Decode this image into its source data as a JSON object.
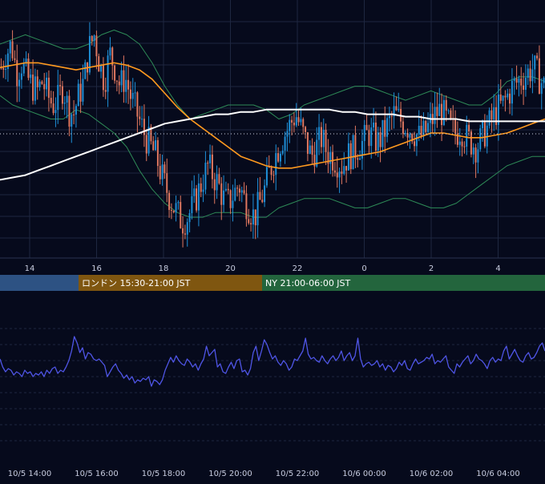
{
  "colors": {
    "background": "#060a1c",
    "grid": "#1e2740",
    "candle_up": "#1e90d8",
    "candle_down": "#e07860",
    "bollinger": "#2e8b57",
    "ma_short": "#ff9a1f",
    "ma_long": "#ffffff",
    "oscillator": "#4f55e6",
    "axis_text": "#c8cde0",
    "session_tokyo": "#2d5283",
    "session_london": "#7f5610",
    "session_ny": "#23653d",
    "current_price_line": "#cfd3e0"
  },
  "sessions": [
    {
      "label": "",
      "color_key": "session_tokyo"
    },
    {
      "label": "ロンドン 15:30-21:00 JST",
      "color_key": "session_london"
    },
    {
      "label": "NY 21:00-06:00 JST",
      "color_key": "session_ny"
    }
  ],
  "main_axis": {
    "tick_labels": [
      "14",
      "16",
      "18",
      "20",
      "22",
      "0",
      "2",
      "4"
    ]
  },
  "bottom_axis": {
    "tick_labels": [
      "10/5 14:00",
      "10/5 16:00",
      "10/5 18:00",
      "10/5 20:00",
      "10/5 22:00",
      "10/6 00:00",
      "10/6 02:00",
      "10/6 04:00"
    ]
  },
  "chart_data": [
    {
      "type": "line",
      "subtype": "candlestick",
      "title": "",
      "x_start": "10/5 13:00",
      "x_end": "10/6 05:40",
      "candle_interval_minutes": 5,
      "ylim": [
        0,
        100
      ],
      "grid": true,
      "legend": "none",
      "close_series": [
        78,
        84,
        88,
        76,
        80,
        74,
        70,
        68,
        72,
        66,
        62,
        64,
        70,
        60,
        58,
        66,
        72,
        86,
        92,
        80,
        72,
        84,
        78,
        70,
        74,
        66,
        60,
        54,
        48,
        44,
        40,
        32,
        26,
        20,
        16,
        12,
        14,
        18,
        24,
        30,
        36,
        32,
        28,
        22,
        20,
        24,
        28,
        22,
        18,
        14,
        20,
        26,
        34,
        40,
        46,
        50,
        54,
        58,
        52,
        46,
        40,
        44,
        48,
        42,
        40,
        38,
        36,
        40,
        42,
        44,
        46,
        50,
        48,
        46,
        50,
        54,
        58,
        56,
        54,
        52,
        50,
        48,
        50,
        54,
        58,
        60,
        56,
        52,
        50,
        52,
        48,
        46,
        44,
        48,
        52,
        56,
        60,
        62,
        66,
        70,
        72,
        74,
        76,
        78,
        74,
        70
      ],
      "series": [
        {
          "name": "",
          "role": "bollinger_upper",
          "values": [
            88,
            90,
            92,
            90,
            88,
            86,
            86,
            88,
            92,
            94,
            92,
            88,
            80,
            70,
            62,
            56,
            58,
            60,
            62,
            62,
            62,
            60,
            56,
            58,
            62,
            64,
            66,
            68,
            70,
            70,
            68,
            66,
            64,
            66,
            68,
            66,
            64,
            62,
            62,
            66,
            72,
            74,
            74,
            72
          ]
        },
        {
          "name": "",
          "role": "bollinger_lower",
          "values": [
            66,
            62,
            60,
            58,
            56,
            56,
            60,
            58,
            54,
            50,
            44,
            34,
            26,
            20,
            16,
            14,
            14,
            16,
            16,
            16,
            14,
            14,
            18,
            20,
            22,
            22,
            22,
            20,
            18,
            18,
            20,
            22,
            22,
            20,
            18,
            18,
            20,
            24,
            28,
            32,
            36,
            38,
            40,
            40
          ]
        },
        {
          "name": "",
          "role": "moving_average_short",
          "values": [
            78,
            79,
            80,
            80,
            79,
            78,
            77,
            78,
            79,
            80,
            79,
            77,
            73,
            67,
            61,
            56,
            52,
            48,
            44,
            40,
            38,
            36,
            35,
            35,
            36,
            37,
            38,
            39,
            40,
            41,
            42,
            44,
            46,
            48,
            50,
            50,
            49,
            48,
            48,
            49,
            50,
            52,
            54,
            56
          ]
        },
        {
          "name": "",
          "role": "moving_average_long",
          "values": [
            30,
            31,
            32,
            34,
            36,
            38,
            40,
            42,
            44,
            46,
            48,
            50,
            52,
            54,
            55,
            56,
            57,
            58,
            58,
            59,
            59,
            60,
            60,
            60,
            60,
            60,
            60,
            59,
            59,
            58,
            58,
            58,
            57,
            57,
            56,
            56,
            56,
            55,
            55,
            55,
            55,
            55,
            55,
            55
          ]
        }
      ]
    },
    {
      "type": "line",
      "title": "",
      "ylim": [
        0,
        100
      ],
      "grid": true,
      "legend": "none",
      "series": [
        {
          "name": "",
          "values": [
            62,
            52,
            46,
            50,
            48,
            42,
            46,
            44,
            40,
            48,
            44,
            46,
            40,
            44,
            42,
            46,
            40,
            48,
            44,
            50,
            52,
            44,
            48,
            46,
            52,
            60,
            72,
            90,
            82,
            70,
            76,
            62,
            70,
            68,
            62,
            60,
            62,
            58,
            54,
            40,
            46,
            52,
            56,
            48,
            44,
            38,
            42,
            36,
            40,
            32,
            36,
            34,
            38,
            36,
            40,
            28,
            36,
            34,
            30,
            36,
            48,
            56,
            64,
            58,
            66,
            60,
            56,
            54,
            62,
            58,
            52,
            56,
            48,
            56,
            62,
            78,
            66,
            70,
            74,
            52,
            56,
            46,
            44,
            52,
            58,
            50,
            60,
            62,
            46,
            48,
            42,
            50,
            70,
            78,
            60,
            72,
            86,
            80,
            70,
            62,
            66,
            58,
            54,
            60,
            56,
            48,
            52,
            62,
            60,
            66,
            72,
            88,
            68,
            62,
            64,
            60,
            58,
            66,
            60,
            56,
            62,
            66,
            60,
            64,
            72,
            60,
            66,
            70,
            60,
            66,
            88,
            62,
            52,
            56,
            58,
            54,
            56,
            60,
            52,
            56,
            48,
            54,
            52,
            46,
            50,
            58,
            54,
            60,
            50,
            48,
            56,
            62,
            56,
            58,
            60,
            64,
            62,
            68,
            56,
            60,
            58,
            62,
            66,
            52,
            48,
            44,
            56,
            52,
            58,
            62,
            66,
            56,
            60,
            68,
            62,
            60,
            56,
            50,
            60,
            64,
            58,
            62,
            60,
            72,
            78,
            62,
            68,
            74,
            66,
            60,
            58,
            66,
            70,
            62,
            64,
            70,
            78,
            82,
            72
          ]
        }
      ]
    }
  ]
}
